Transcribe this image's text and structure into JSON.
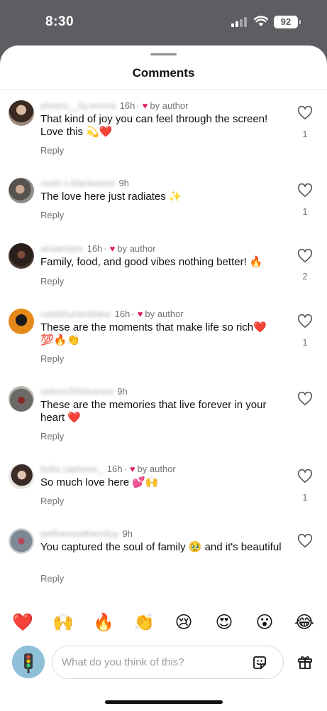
{
  "status_bar": {
    "time": "8:30",
    "battery": "92"
  },
  "sheet": {
    "title": "Comments"
  },
  "comments": [
    {
      "username": "photos__by.emma",
      "time": "16h",
      "by_author": "by author",
      "text": "That kind of joy you can feel through the screen! Love this 💫❤️",
      "reply": "Reply",
      "likes": "1"
    },
    {
      "username": "noah.o.blackwood",
      "time": "9h",
      "by_author": "",
      "text": "The love here just radiates ✨",
      "reply": "Reply",
      "likes": "1"
    },
    {
      "username": "ariaartsips",
      "time": "16h",
      "by_author": "by author",
      "text": "Family, food, and good vibes nothing better! 🔥",
      "reply": "Reply",
      "likes": "2"
    },
    {
      "username": "calebhunterblake",
      "time": "16h",
      "by_author": "by author",
      "text": "These are the moments that make life so rich❤️ 💯🔥👏",
      "reply": "Reply",
      "likes": "1"
    },
    {
      "username": "selene2060vareia",
      "time": "9h",
      "by_author": "",
      "text": "These are the memories that live forever in your heart ❤️",
      "reply": "Reply",
      "likes": ""
    },
    {
      "username": "bella.captures_",
      "time": "16h",
      "by_author": "by author",
      "text": "So much love here 💕🙌",
      "reply": "Reply",
      "likes": "1"
    },
    {
      "username": "wellnesswithemilyy",
      "time": "9h",
      "by_author": "",
      "text": "You captured the soul of family 🥹 and it's beautiful",
      "reply": "Reply",
      "likes": ""
    }
  ],
  "quick_emojis": [
    "❤️",
    "🙌",
    "🔥",
    "👏",
    "😢",
    "😍",
    "😮",
    "😂"
  ],
  "compose": {
    "placeholder": "What do you think of this?",
    "value": ""
  },
  "icons": {
    "like": "heart-outline-icon",
    "sticker": "sticker-icon",
    "gift": "gift-icon",
    "author_like": "heart-filled-icon"
  },
  "colors": {
    "author_heart": "#e0245e",
    "status_bar": "#5c5e62",
    "meta_text": "#737373"
  }
}
